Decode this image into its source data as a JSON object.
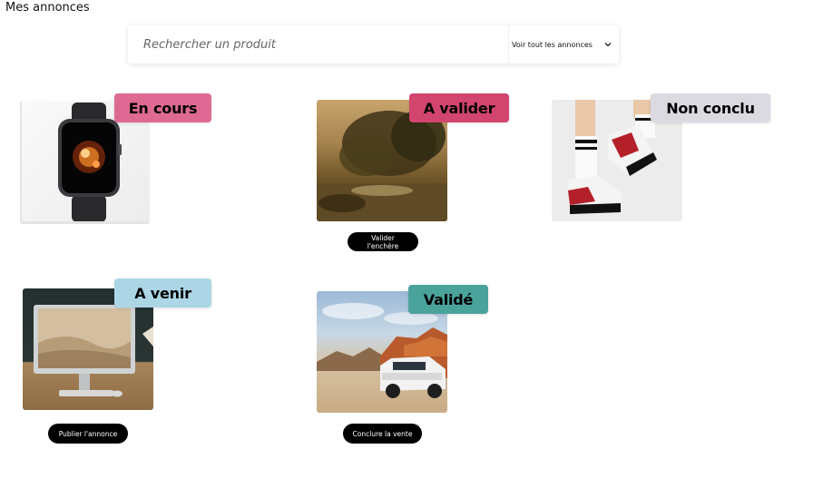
{
  "header": {
    "title": "Mes annonces"
  },
  "search": {
    "placeholder": "Rechercher un produit",
    "value": ""
  },
  "filter": {
    "selected": "Voir tout les annonces",
    "icon": "chevron-down-icon"
  },
  "listings": [
    {
      "status": "En cours",
      "status_color": "#de6a93",
      "image": "smartwatch-image"
    },
    {
      "status": "A valider",
      "status_color": "#d2456e",
      "image": "landscape-painting-image",
      "action": "Valider l'enchère"
    },
    {
      "status": "Non conclu",
      "status_color": "#dcdae1",
      "image": "sneakers-image"
    },
    {
      "status": "A venir",
      "status_color": "#acd6e6",
      "image": "imac-desk-image",
      "action": "Publier l'annonce"
    },
    {
      "status": "Validé",
      "status_color": "#4aa39b",
      "image": "suv-desert-image",
      "action": "Conclure la vente"
    }
  ]
}
